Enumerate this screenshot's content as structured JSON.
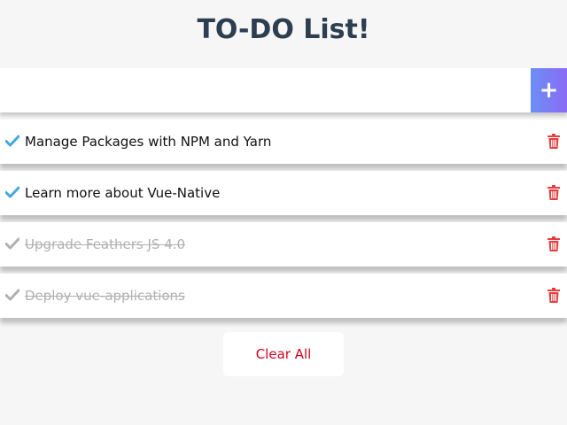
{
  "header": {
    "title": "TO-DO List!"
  },
  "input": {
    "value": "",
    "placeholder": "",
    "add_label": "+",
    "add_icon": "plus-icon"
  },
  "colors": {
    "title": "#2c3e50",
    "check_active": "#41a9e0",
    "check_done": "#b0b0b0",
    "trash": "#e53e3e",
    "clear_text": "#d0021b",
    "add_gradient_start": "#6b8ef5",
    "add_gradient_end": "#8a6cf5"
  },
  "todos": [
    {
      "text": "Manage Packages with NPM and Yarn",
      "completed": false
    },
    {
      "text": "Learn more about Vue-Native",
      "completed": false
    },
    {
      "text": "Upgrade Feathers JS 4.0",
      "completed": true
    },
    {
      "text": "Deploy vue-applications",
      "completed": true
    }
  ],
  "footer": {
    "clear_label": "Clear All"
  }
}
